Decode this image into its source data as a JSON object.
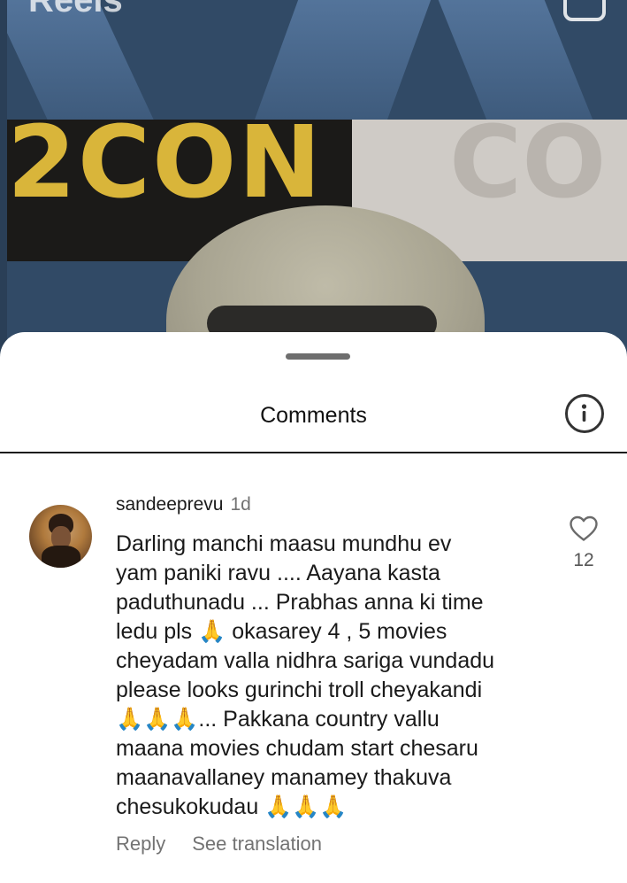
{
  "header": {
    "title": "Reels",
    "camera_icon": "camera-icon"
  },
  "video": {
    "banner_text": "2CON",
    "banner_text_right": "CO"
  },
  "sheet": {
    "title": "Comments",
    "info_icon": "info-icon"
  },
  "comment": {
    "username": "sandeeprevu",
    "time": "1d",
    "text": "Darling manchi maasu mundhu ev\nyam paniki ravu .... Aayana kasta\npaduthunadu ... Prabhas anna ki time\nledu pls 🙏 okasarey 4 , 5 movies\ncheyadam valla nidhra sariga vundadu\nplease looks gurinchi troll cheyakandi\n🙏🙏🙏... Pakkana country vallu\nmaana movies chudam start chesaru\nmaanavallaney manamey thakuva\nchesukokudau 🙏🙏🙏",
    "like_count": "12",
    "reply_label": "Reply",
    "translate_label": "See translation"
  },
  "colors": {
    "sheet_bg": "#ffffff",
    "secondary_text": "#737373",
    "banner_yellow": "#d9b53a"
  }
}
